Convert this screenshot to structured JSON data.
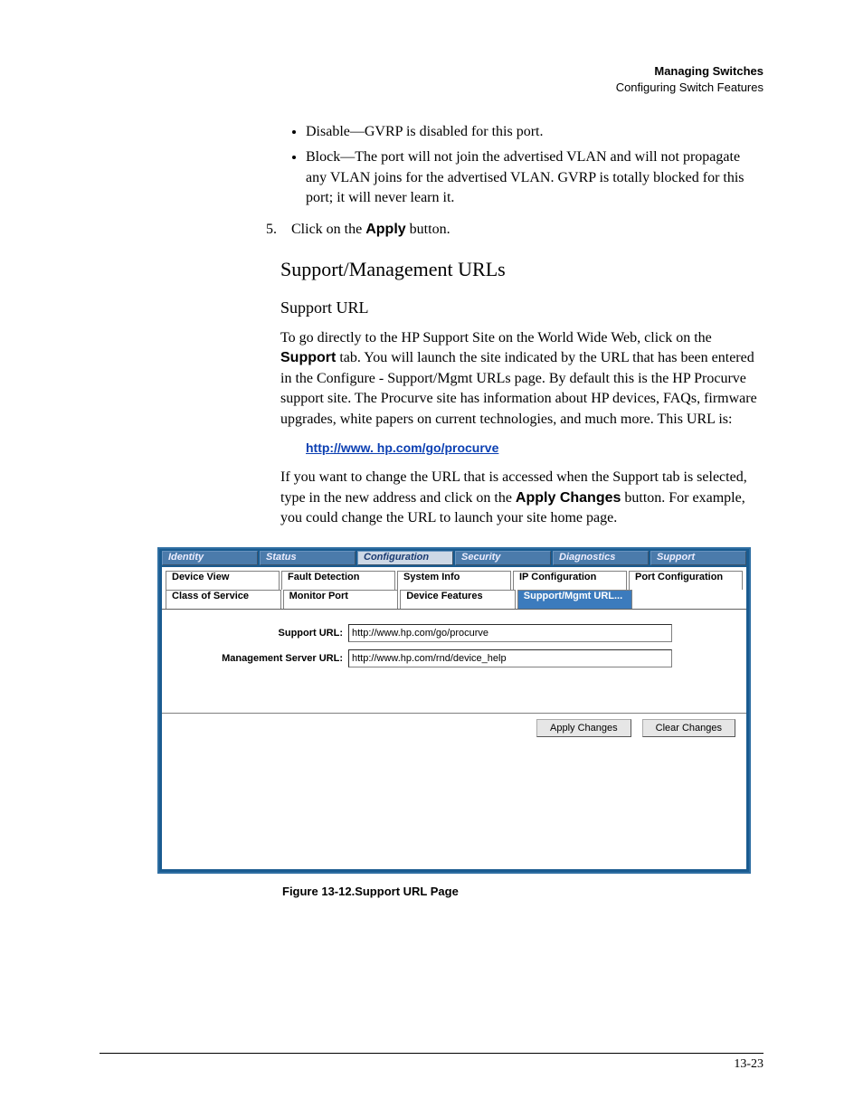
{
  "header": {
    "title": "Managing Switches",
    "subtitle": "Configuring Switch Features"
  },
  "content": {
    "bullet1": "Disable—GVRP is disabled for this port.",
    "bullet2": "Block—The port will not join the advertised VLAN and will not propagate any VLAN joins for the advertised VLAN. GVRP is totally blocked for this port; it will never learn it.",
    "step5_prefix": "5.",
    "step5_text_a": "Click on the ",
    "step5_bold": "Apply",
    "step5_text_b": " button.",
    "h2": "Support/Management URLs",
    "h3": "Support URL",
    "p1a": "To go directly to the HP Support Site on the World Wide Web, click on the ",
    "p1bold": "Support",
    "p1b": " tab. You will launch the site indicated by the URL that has been entered in the Configure - Support/Mgmt URLs page. By default this is the HP Procurve support site. The Procurve site has information about HP devices, FAQs, firmware upgrades, white papers on current technologies, and much more. This URL is:",
    "link": "http://www. hp.com/go/procurve",
    "p2a": "If you want to change the URL that is accessed when the Support tab is selected, type in the new address and click on the ",
    "p2bold": "Apply Changes",
    "p2b": " button. For example, you could change the URL to launch your site home page."
  },
  "tabs": {
    "main": [
      "Identity",
      "Status",
      "Configuration",
      "Security",
      "Diagnostics",
      "Support"
    ],
    "sub_row1": [
      "Device View",
      "Fault Detection",
      "System Info",
      "IP Configuration",
      "Port Configuration"
    ],
    "sub_row2": [
      "Class of Service",
      "Monitor Port",
      "Device Features",
      "Support/Mgmt URL..."
    ]
  },
  "form": {
    "support_label": "Support URL:",
    "support_value": "http://www.hp.com/go/procurve",
    "mgmt_label": "Management Server URL:",
    "mgmt_value": "http://www.hp.com/rnd/device_help",
    "apply_btn": "Apply Changes",
    "clear_btn": "Clear Changes"
  },
  "caption": "Figure 13-12.Support URL Page",
  "page_number": "13-23"
}
